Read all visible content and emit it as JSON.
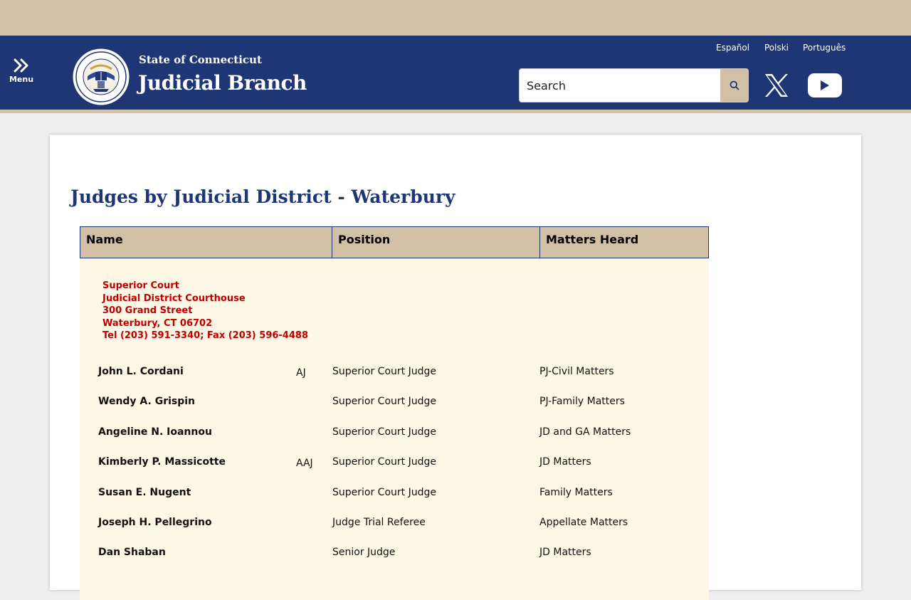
{
  "header": {
    "menu_label": "Menu",
    "brand_top": "State of Connecticut",
    "brand_main": "Judicial Branch",
    "languages": [
      "Español",
      "Polski",
      "Português"
    ],
    "search_placeholder": "Search"
  },
  "icons": {
    "menu": "double-chevron-right-icon",
    "seal": "connecticut-judicial-seal",
    "search": "magnifier-icon",
    "x": "x-logo-icon",
    "youtube": "youtube-play-icon"
  },
  "colors": {
    "header_bg": "#1f3674",
    "accent_tan": "#d1c0a6",
    "court_text": "#c00000",
    "table_body_bg": "#fdf7e5"
  },
  "page": {
    "title": "Judges by Judicial District - Waterbury"
  },
  "table": {
    "headers": [
      "Name",
      "Position",
      "Matters Heard"
    ],
    "court_info": [
      "Superior Court",
      "Judicial District Courthouse",
      "300 Grand Street",
      "Waterbury, CT 06702",
      "Tel (203) 591-3340; Fax (203) 596-4488"
    ],
    "rows": [
      {
        "name": "John L. Cordani",
        "title": "AJ",
        "position": "Superior Court Judge",
        "matters": "PJ-Civil Matters"
      },
      {
        "name": "Wendy A. Grispin",
        "title": "",
        "position": "Superior Court Judge",
        "matters": "PJ-Family Matters"
      },
      {
        "name": "Angeline N. Ioannou",
        "title": "",
        "position": "Superior Court Judge",
        "matters": "JD and GA Matters"
      },
      {
        "name": "Kimberly P. Massicotte",
        "title": "AAJ",
        "position": "Superior Court Judge",
        "matters": "JD Matters"
      },
      {
        "name": "Susan E. Nugent",
        "title": "",
        "position": "Superior Court Judge",
        "matters": "Family Matters"
      },
      {
        "name": "Joseph H. Pellegrino",
        "title": "",
        "position": "Judge Trial Referee",
        "matters": "Appellate Matters"
      },
      {
        "name": "Dan Shaban",
        "title": "",
        "position": "Senior Judge",
        "matters": "JD Matters"
      }
    ]
  }
}
